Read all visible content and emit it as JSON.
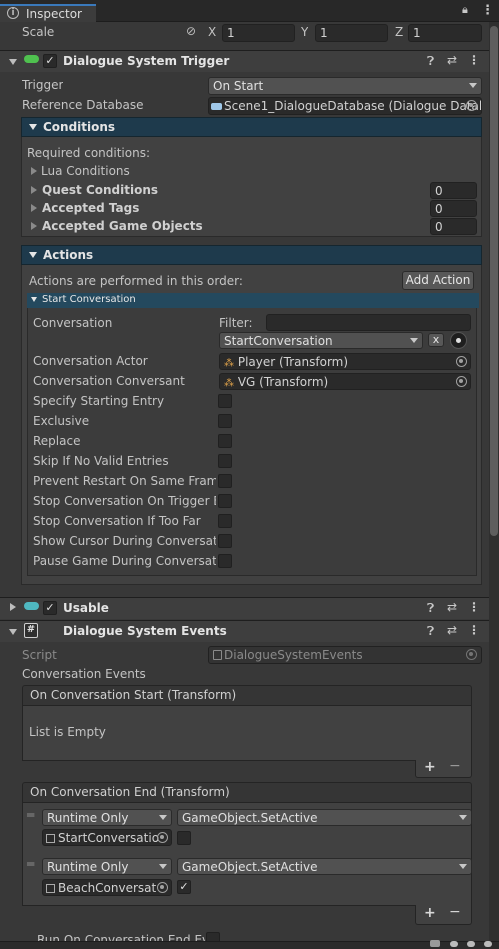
{
  "tab": {
    "title": "Inspector"
  },
  "scale": {
    "label": "Scale",
    "x_label": "X",
    "x": "1",
    "y_label": "Y",
    "y": "1",
    "z_label": "Z",
    "z": "1"
  },
  "trigger_component": {
    "title": "Dialogue System Trigger",
    "trigger_label": "Trigger",
    "trigger_value": "On Start",
    "refdb_label": "Reference Database",
    "refdb_value": "Scene1_DialogueDatabase (Dialogue Datal",
    "conditions": {
      "header": "Conditions",
      "required": "Required conditions:",
      "lua": "Lua Conditions",
      "quest": "Quest Conditions",
      "quest_count": "0",
      "tags": "Accepted Tags",
      "tags_count": "0",
      "gameobjects": "Accepted Game Objects",
      "gameobjects_count": "0"
    },
    "actions": {
      "header": "Actions",
      "order_text": "Actions are performed in this order:",
      "add_action": "Add Action",
      "start_conversation": {
        "header": "Start Conversation",
        "conversation_label": "Conversation",
        "filter_label": "Filter:",
        "filter_value": "",
        "conversation_value": "StartConversation",
        "clear_button": "x",
        "actor_label": "Conversation Actor",
        "actor_value": "Player (Transform)",
        "conversant_label": "Conversation Conversant",
        "conversant_value": "VG (Transform)",
        "toggles": [
          {
            "label": "Specify Starting Entry",
            "checked": false
          },
          {
            "label": "Exclusive",
            "checked": false
          },
          {
            "label": "Replace",
            "checked": false
          },
          {
            "label": "Skip If No Valid Entries",
            "checked": false
          },
          {
            "label": "Prevent Restart On Same Frame",
            "checked": false
          },
          {
            "label": "Stop Conversation On Trigger Ex",
            "checked": false
          },
          {
            "label": "Stop Conversation If Too Far",
            "checked": false
          },
          {
            "label": "Show Cursor During Conversatio",
            "checked": false
          },
          {
            "label": "Pause Game During Conversatio",
            "checked": false
          }
        ]
      }
    }
  },
  "usable_component": {
    "title": "Usable"
  },
  "events_component": {
    "title": "Dialogue System Events",
    "script_label": "Script",
    "script_value": "DialogueSystemEvents",
    "conv_events_label": "Conversation Events",
    "on_start": {
      "header": "On Conversation Start (Transform)",
      "empty_text": "List is Empty"
    },
    "on_end": {
      "header": "On Conversation End (Transform)",
      "entries": [
        {
          "runtime": "Runtime Only",
          "function": "GameObject.SetActive",
          "object": "StartConversatio",
          "checked": false
        },
        {
          "runtime": "Runtime Only",
          "function": "GameObject.SetActive",
          "object": "BeachConversat",
          "checked": true
        }
      ]
    },
    "next_label": "Run On Conversation End Eve"
  },
  "icons": [
    "lock-icon",
    "menu-icon",
    "help-icon",
    "sliders-icon",
    "more-icon",
    "link-icon",
    "object-icon",
    "circle-select-icon",
    "plus-icon",
    "minus-icon",
    "drag-handle-icon",
    "script-icon"
  ],
  "colors": {
    "accent_header": "#1e3a4c",
    "subheader": "#24495e",
    "background": "#383838",
    "field": "#2a2a2a"
  }
}
